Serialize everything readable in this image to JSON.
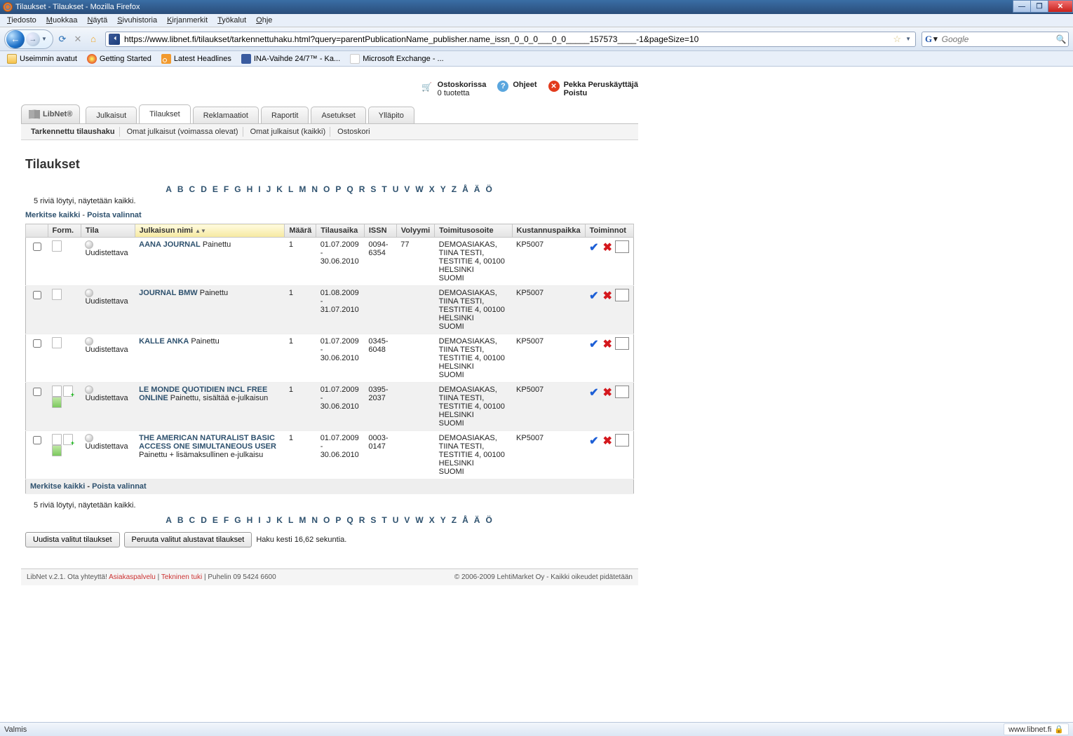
{
  "window": {
    "title": "Tilaukset - Tilaukset - Mozilla Firefox",
    "menus": [
      "Tiedosto",
      "Muokkaa",
      "Näytä",
      "Sivuhistoria",
      "Kirjanmerkit",
      "Työkalut",
      "Ohje"
    ],
    "url": "https://www.libnet.fi/tilaukset/tarkennettuhaku.html?query=parentPublicationName_publisher.name_issn_0_0_0___0_0_____157573____-1&pageSize=10",
    "search_placeholder": "Google",
    "status": "Valmis",
    "status_site": "www.libnet.fi"
  },
  "bookmarks": [
    {
      "label": "Useimmin avatut"
    },
    {
      "label": "Getting Started"
    },
    {
      "label": "Latest Headlines"
    },
    {
      "label": "INA-Vaihde 24/7™ - Ka..."
    },
    {
      "label": "Microsoft Exchange - ..."
    }
  ],
  "header": {
    "cart_l1": "Ostoskorissa",
    "cart_l2": "0 tuotetta",
    "help": "Ohjeet",
    "user_l1": "Pekka Peruskäyttäjä",
    "user_l2": "Poistu"
  },
  "logo_text": "LibNet®",
  "maintabs": [
    "Julkaisut",
    "Tilaukset",
    "Reklamaatiot",
    "Raportit",
    "Asetukset",
    "Ylläpito"
  ],
  "subnav": [
    "Tarkennettu tilaushaku",
    "Omat julkaisut (voimassa olevat)",
    "Omat julkaisut (kaikki)",
    "Ostoskori"
  ],
  "h1": "Tilaukset",
  "alpha": [
    "A",
    "B",
    "C",
    "D",
    "E",
    "F",
    "G",
    "H",
    "I",
    "J",
    "K",
    "L",
    "M",
    "N",
    "O",
    "P",
    "Q",
    "R",
    "S",
    "T",
    "U",
    "V",
    "W",
    "X",
    "Y",
    "Z",
    "Å",
    "Ä",
    "Ö"
  ],
  "resultline": "5 riviä löytyi, näytetään kaikki.",
  "select_all": "Merkitse kaikki",
  "clear_sel": "Poista valinnat",
  "cols": {
    "form": "Form.",
    "tila": "Tila",
    "julk": "Julkaisun nimi",
    "maara": "Määrä",
    "aika": "Tilausaika",
    "issn": "ISSN",
    "vol": "Volyymi",
    "toimitus": "Toimitusosoite",
    "kp": "Kustannuspaikka",
    "toim": "Toiminnot"
  },
  "rows": [
    {
      "tila": "Uudistettava",
      "pub": "AANA JOURNAL",
      "fmt": "Painettu",
      "maara": "1",
      "aika": "01.07.2009 - 30.06.2010",
      "issn": "0094-6354",
      "vol": "77",
      "addr": "DEMOASIAKAS, TIINA TESTI, TESTITIE 4, 00100 HELSINKI, SUOMI",
      "kp": "KP5007",
      "icons": [
        "print"
      ]
    },
    {
      "tila": "Uudistettava",
      "pub": "JOURNAL BMW",
      "fmt": "Painettu",
      "maara": "1",
      "aika": "01.08.2009 - 31.07.2010",
      "issn": "",
      "vol": "",
      "addr": "DEMOASIAKAS, TIINA TESTI, TESTITIE 4, 00100 HELSINKI, SUOMI",
      "kp": "KP5007",
      "icons": [
        "print"
      ]
    },
    {
      "tila": "Uudistettava",
      "pub": "KALLE ANKA",
      "fmt": "Painettu",
      "maara": "1",
      "aika": "01.07.2009 - 30.06.2010",
      "issn": "0345-6048",
      "vol": "",
      "addr": "DEMOASIAKAS, TIINA TESTI, TESTITIE 4, 00100 HELSINKI, SUOMI",
      "kp": "KP5007",
      "icons": [
        "print"
      ]
    },
    {
      "tila": "Uudistettava",
      "pub": "LE MONDE QUOTIDIEN INCL FREE ONLINE",
      "fmt": "Painettu, sisältää e-julkaisun",
      "maara": "1",
      "aika": "01.07.2009 - 30.06.2010",
      "issn": "0395-2037",
      "vol": "",
      "addr": "DEMOASIAKAS, TIINA TESTI, TESTITIE 4, 00100 HELSINKI, SUOMI",
      "kp": "KP5007",
      "icons": [
        "print",
        "plus",
        "online"
      ]
    },
    {
      "tila": "Uudistettava",
      "pub": "THE AMERICAN NATURALIST BASIC ACCESS ONE SIMULTANEOUS USER",
      "fmt": "Painettu + lisämaksullinen e-julkaisu",
      "maara": "1",
      "aika": "01.07.2009 - 30.06.2010",
      "issn": "0003-0147",
      "vol": "",
      "addr": "DEMOASIAKAS, TIINA TESTI, TESTITIE 4, 00100 HELSINKI, SUOMI",
      "kp": "KP5007",
      "icons": [
        "print",
        "plus",
        "online"
      ]
    }
  ],
  "btn_renew": "Uudista valitut tilaukset",
  "btn_cancel": "Peruuta valitut alustavat tilaukset",
  "timing": "Haku kesti 16,62 sekuntia.",
  "footer": {
    "left_pre": "LibNet v.2.1. Ota yhteyttä! ",
    "link1": "Asiakaspalvelu",
    "link2": "Tekninen tuki",
    "left_post": " | Puhelin 09 5424 6600",
    "right": "© 2006-2009 LehtiMarket Oy - Kaikki oikeudet pidätetään"
  }
}
